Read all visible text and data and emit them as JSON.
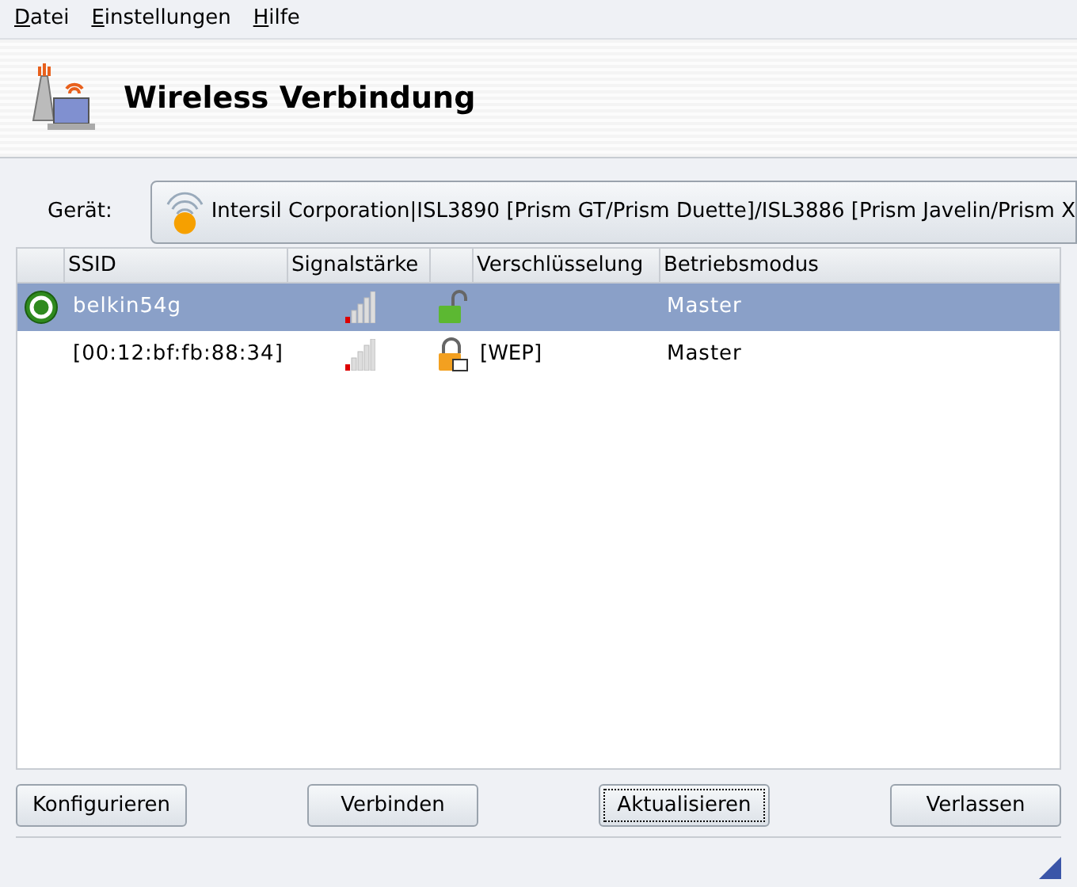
{
  "menu": [
    "Datei",
    "Einstellungen",
    "Hilfe"
  ],
  "header": {
    "title": "Wireless Verbindung"
  },
  "device": {
    "label": "Gerät:",
    "value": "Intersil Corporation|ISL3890 [Prism GT/Prism Duette]/ISL3886 [Prism Javelin/Prism X"
  },
  "table": {
    "columns": [
      "SSID",
      "Signalstärke",
      "Verschlüsselung",
      "Betriebsmodus"
    ],
    "rows": [
      {
        "selected": true,
        "connected": true,
        "ssid": "belkin54g",
        "encrypted": false,
        "encryption": "",
        "mode": "Master"
      },
      {
        "selected": false,
        "connected": false,
        "ssid": "[00:12:bf:fb:88:34]",
        "encrypted": true,
        "encryption": "[WEP]",
        "mode": "Master"
      }
    ]
  },
  "buttons": [
    {
      "label": "Konfigurieren",
      "focused": false
    },
    {
      "label": "Verbinden",
      "focused": false
    },
    {
      "label": "Aktualisieren",
      "focused": true
    },
    {
      "label": "Verlassen",
      "focused": false
    }
  ]
}
